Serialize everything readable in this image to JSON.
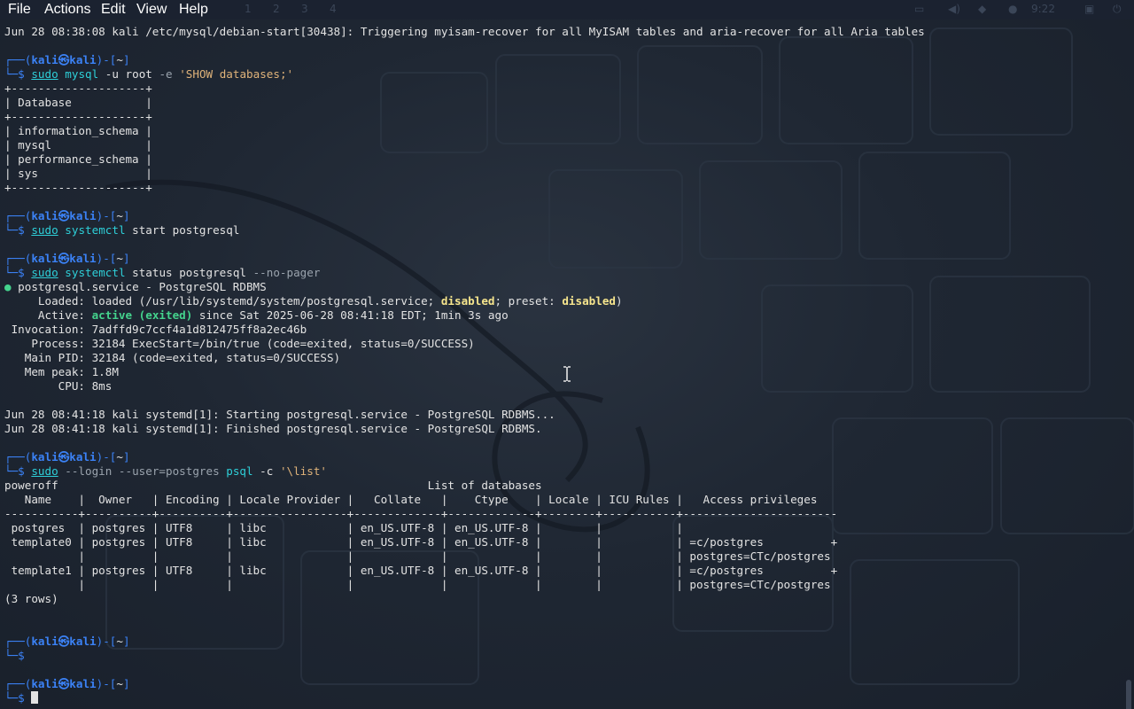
{
  "menu": {
    "items": [
      "File",
      "Actions",
      "Edit",
      "View",
      "Help"
    ],
    "workspaces": [
      "1",
      "2",
      "3",
      "4"
    ],
    "clock": "9:22"
  },
  "colors": {
    "background": "#1b2230",
    "prompt_frame": "#3b82f6",
    "command": "#2ecfd8",
    "string": "#e0b37a",
    "warning": "#f6e58d",
    "active": "#44d38d",
    "text": "#e3e3e3"
  },
  "prompt": {
    "user": "kali",
    "at_symbol": "㉿",
    "host": "kali",
    "path": "~"
  },
  "terminal": {
    "line_01": "Jun 28 08:38:08 kali /etc/mysql/debian-start[30438]: Triggering myisam-recover for all MyISAM tables and aria-recover for all Aria tables",
    "cmd1": {
      "sudo": "sudo",
      "bin": "mysql",
      "args": " -u root ",
      "opt": "-e",
      "str": " 'SHOW databases;'"
    },
    "mysql_table": {
      "border": "+--------------------+",
      "header": "| Database           |",
      "rows": [
        "| information_schema |",
        "| mysql              |",
        "| performance_schema |",
        "| sys                |"
      ]
    },
    "cmd2": {
      "sudo": "sudo",
      "bin": "systemctl",
      "args": " start postgresql"
    },
    "cmd3": {
      "sudo": "sudo",
      "bin": "systemctl",
      "args": " status postgresql ",
      "opt": "--no-pager"
    },
    "status": {
      "dot": "●",
      "service_line": " postgresql.service - PostgreSQL RDBMS",
      "loaded_pre": "     Loaded: loaded (/usr/lib/systemd/system/postgresql.service; ",
      "loaded_disabled1": "disabled",
      "loaded_mid": "; preset: ",
      "loaded_disabled2": "disabled",
      "loaded_post": ")",
      "active_pre": "     Active: ",
      "active_value": "active (exited)",
      "active_post": " since Sat 2025-06-28 08:41:18 EDT; 1min 3s ago",
      "invocation": " Invocation: 7adffd9c7ccf4a1d812475ff8a2ec46b",
      "process": "    Process: 32184 ExecStart=/bin/true (code=exited, status=0/SUCCESS)",
      "main_pid": "   Main PID: 32184 (code=exited, status=0/SUCCESS)",
      "mem_peak": "   Mem peak: 1.8M",
      "cpu": "        CPU: 8ms",
      "log1": "Jun 28 08:41:18 kali systemd[1]: Starting postgresql.service - PostgreSQL RDBMS...",
      "log2": "Jun 28 08:41:18 kali systemd[1]: Finished postgresql.service - PostgreSQL RDBMS."
    },
    "cmd4": {
      "sudo": "sudo",
      "opt": " --login --user=postgres",
      "bin": " psql",
      "args": " -c ",
      "str": "'\\list'"
    },
    "psql": {
      "line_a": "poweroff                                                       List of databases",
      "header": "   Name    |  Owner   | Encoding | Locale Provider |   Collate   |    Ctype    | Locale | ICU Rules |   Access privileges   ",
      "divider": "-----------+----------+----------+-----------------+-------------+-------------+--------+-----------+-----------------------",
      "rows": [
        " postgres  | postgres | UTF8     | libc            | en_US.UTF-8 | en_US.UTF-8 |        |           | ",
        " template0 | postgres | UTF8     | libc            | en_US.UTF-8 | en_US.UTF-8 |        |           | =c/postgres          +",
        "           |          |          |                 |             |             |        |           | postgres=CTc/postgres",
        " template1 | postgres | UTF8     | libc            | en_US.UTF-8 | en_US.UTF-8 |        |           | =c/postgres          +",
        "           |          |          |                 |             |             |        |           | postgres=CTc/postgres"
      ],
      "count": "(3 rows)"
    }
  }
}
